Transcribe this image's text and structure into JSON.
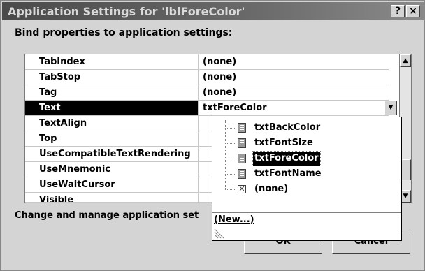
{
  "window": {
    "title": "Application Settings for 'lblForeColor'",
    "help_glyph": "?",
    "close_glyph": "×"
  },
  "heading": "Bind properties to application settings:",
  "properties": [
    {
      "name": "TabIndex",
      "value": "(none)"
    },
    {
      "name": "TabStop",
      "value": "(none)"
    },
    {
      "name": "Tag",
      "value": "(none)"
    },
    {
      "name": "Text",
      "value": "txtForeColor",
      "selected": true
    },
    {
      "name": "TextAlign",
      "value": ""
    },
    {
      "name": "Top",
      "value": ""
    },
    {
      "name": "UseCompatibleTextRendering",
      "value": ""
    },
    {
      "name": "UseMnemonic",
      "value": ""
    },
    {
      "name": "UseWaitCursor",
      "value": ""
    },
    {
      "name": "Visible",
      "value": ""
    }
  ],
  "dropdown": {
    "items": [
      {
        "label": "txtBackColor",
        "icon": "setting-icon"
      },
      {
        "label": "txtFontSize",
        "icon": "setting-icon"
      },
      {
        "label": "txtForeColor",
        "icon": "setting-icon",
        "selected": true
      },
      {
        "label": "txtFontName",
        "icon": "setting-icon"
      },
      {
        "label": "(none)",
        "icon": "none-icon"
      }
    ],
    "new_label": "(New...)"
  },
  "footer": {
    "manage_text": "Change and manage application set",
    "ok_label": "OK",
    "cancel_label": "Cancel"
  }
}
